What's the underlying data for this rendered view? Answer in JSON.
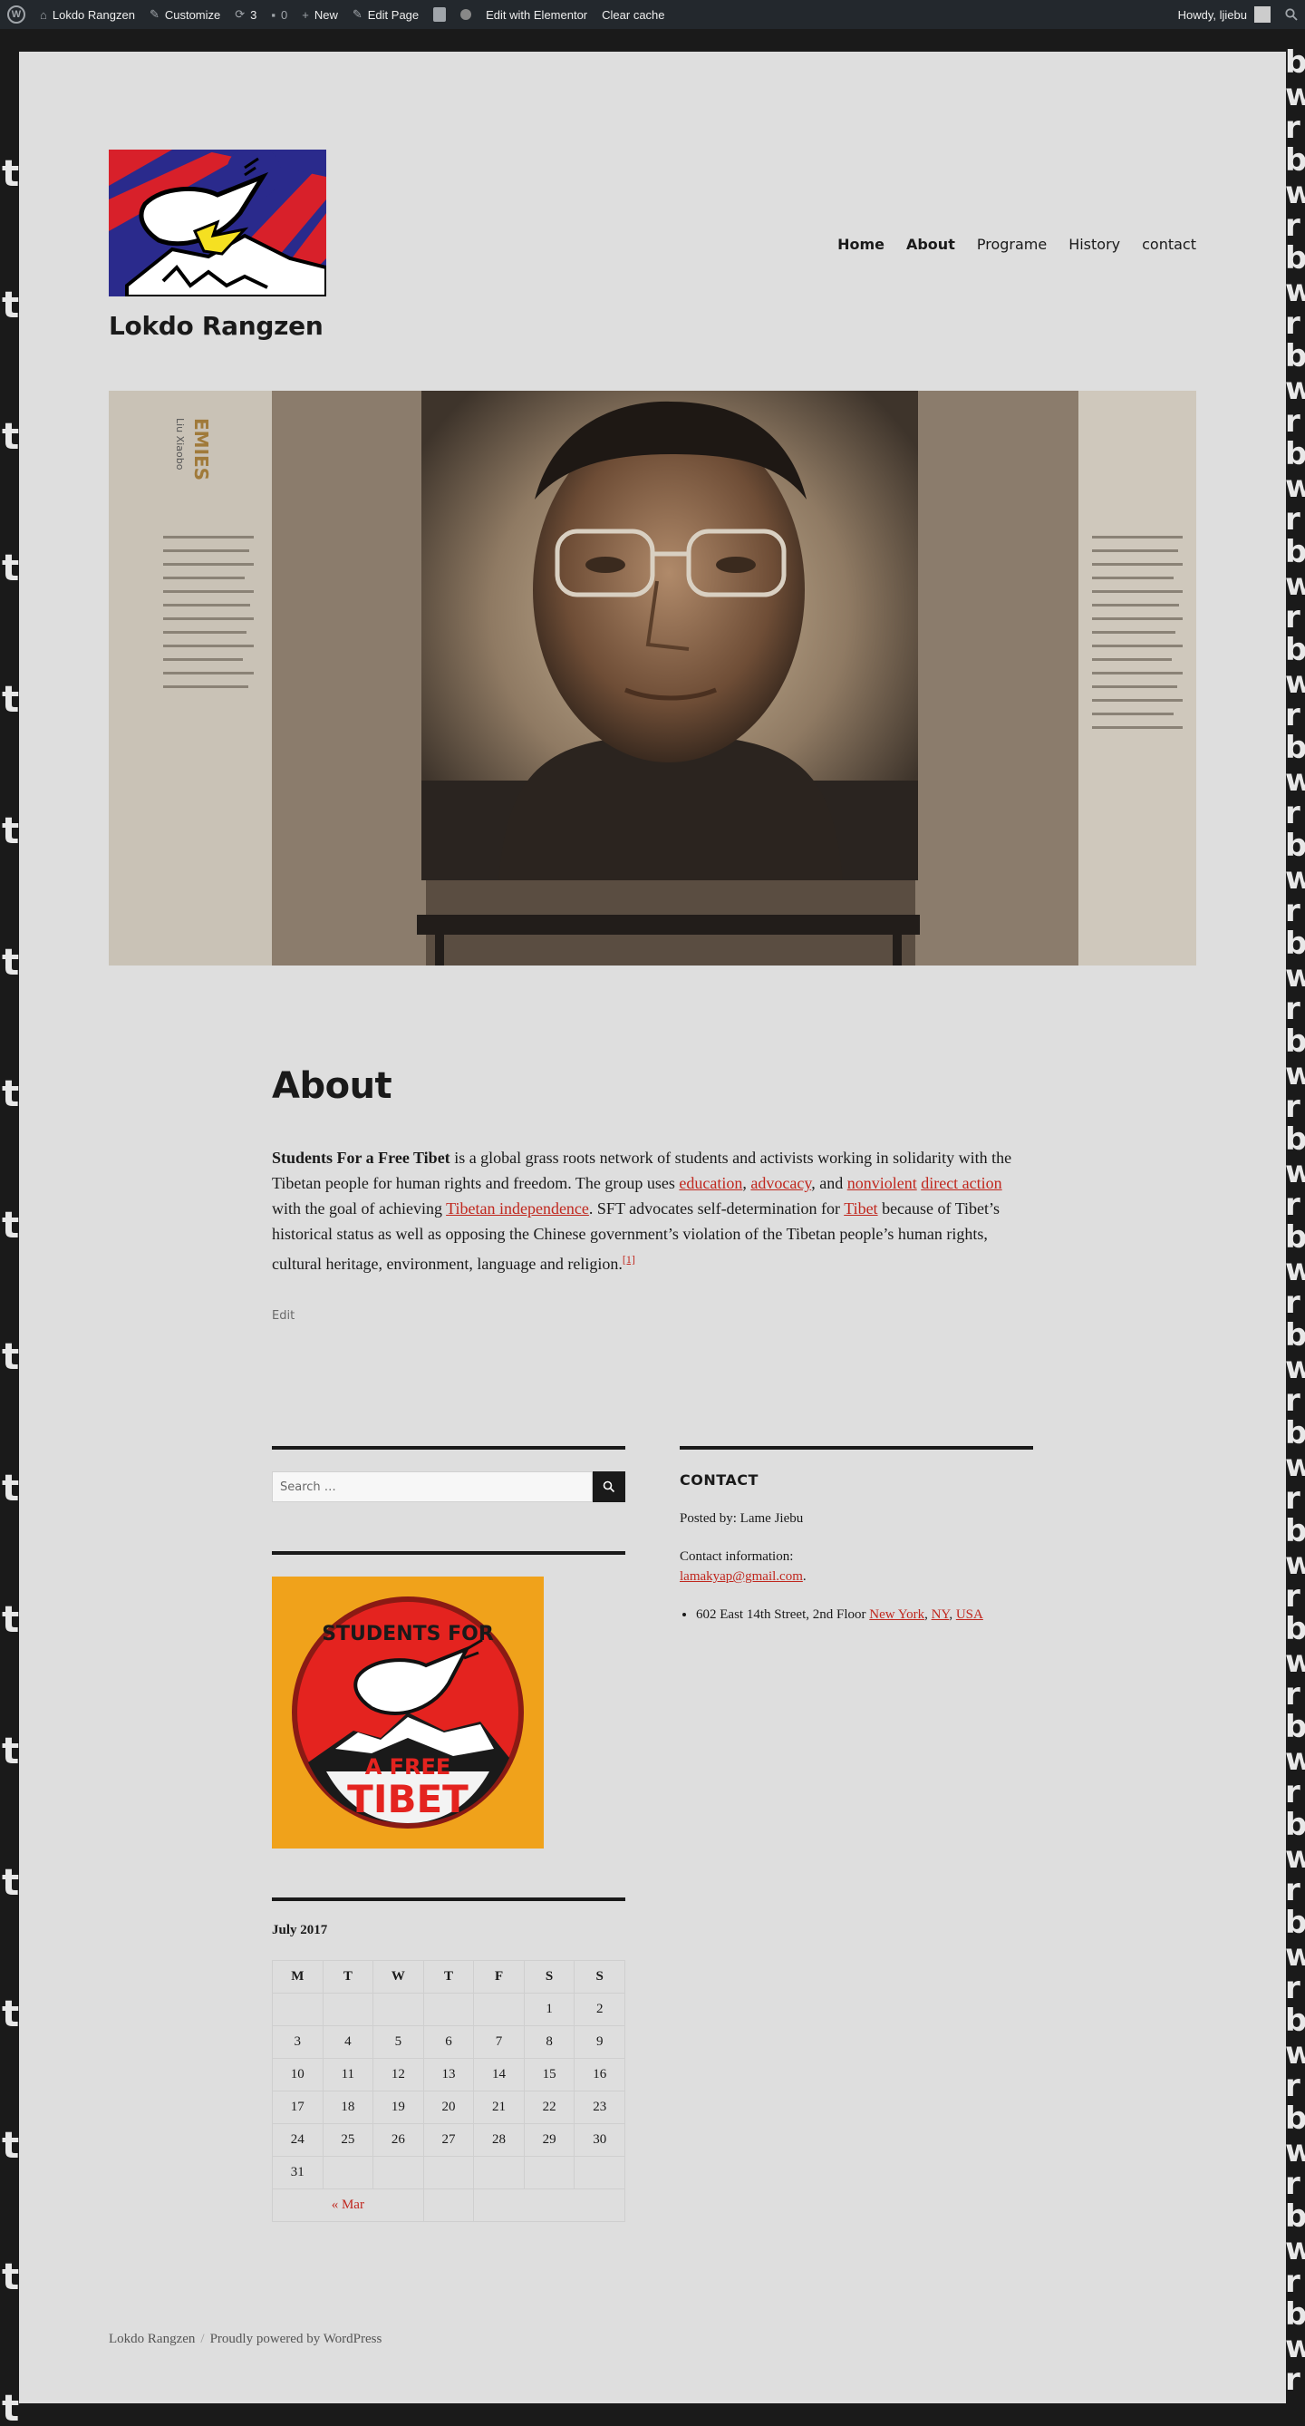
{
  "adminbar": {
    "site_name": "Lokdo Rangzen",
    "customize": "Customize",
    "updates_count": "3",
    "comments_count": "0",
    "new": "New",
    "edit_page": "Edit Page",
    "edit_elementor": "Edit with Elementor",
    "clear_cache": "Clear cache",
    "howdy": "Howdy, ljiebu"
  },
  "header": {
    "site_title": "Lokdo Rangzen",
    "nav": [
      "Home",
      "About",
      "Programe",
      "History",
      "contact"
    ]
  },
  "entry": {
    "title": "About",
    "lead_bold": "Students For a Free Tibet",
    "p1": " is a global grass roots network of students and activists working in solidarity with the Tibetan people for human rights and freedom. The group uses ",
    "link_education": "education",
    "comma1": ", ",
    "link_advocacy": "advocacy",
    "comma2": ", and ",
    "link_nonviolent": "nonviolent",
    "space1": " ",
    "link_direct_action": "direct action",
    "p2": " with the goal of achieving ",
    "link_independence": "Tibetan independence",
    "p3": ". SFT advocates self-determination for ",
    "link_tibet": "Tibet",
    "p4": " because of Tibet’s historical status as well as opposing the Chinese government’s violation of the Tibetan people’s human rights, cultural heritage, environment, language and religion.",
    "footnote": "[1]",
    "edit": "Edit"
  },
  "sidebar": {
    "search_placeholder": "Search …",
    "badge_text_top": "STUDENTS FOR",
    "badge_text_mid": "A FREE",
    "badge_text_bottom": "TIBET",
    "calendar": {
      "caption": "July 2017",
      "headers": [
        "M",
        "T",
        "W",
        "T",
        "F",
        "S",
        "S"
      ],
      "rows": [
        [
          "",
          "",
          "",
          "",
          "",
          "1",
          "2"
        ],
        [
          "3",
          "4",
          "5",
          "6",
          "7",
          "8",
          "9"
        ],
        [
          "10",
          "11",
          "12",
          "13",
          "14",
          "15",
          "16"
        ],
        [
          "17",
          "18",
          "19",
          "20",
          "21",
          "22",
          "23"
        ],
        [
          "24",
          "25",
          "26",
          "27",
          "28",
          "29",
          "30"
        ],
        [
          "31",
          "",
          "",
          "",
          "",
          "",
          ""
        ]
      ],
      "prev": "« Mar"
    }
  },
  "contact": {
    "title": "CONTACT",
    "posted_by": "Posted by: Lame Jiebu",
    "contact_info_label": "Contact information:",
    "email": "lamakyap@gmail.com",
    "period": ".",
    "address_prefix": "602 East 14th Street, 2nd Floor ",
    "city": "New York",
    "state": "NY",
    "country": "USA"
  },
  "footer": {
    "site": "Lokdo Rangzen",
    "sep": "/",
    "powered": "Proudly powered by WordPress"
  },
  "hero_text": {
    "left_title": "EMIES",
    "left_sub": "Liu Xiaobo"
  }
}
